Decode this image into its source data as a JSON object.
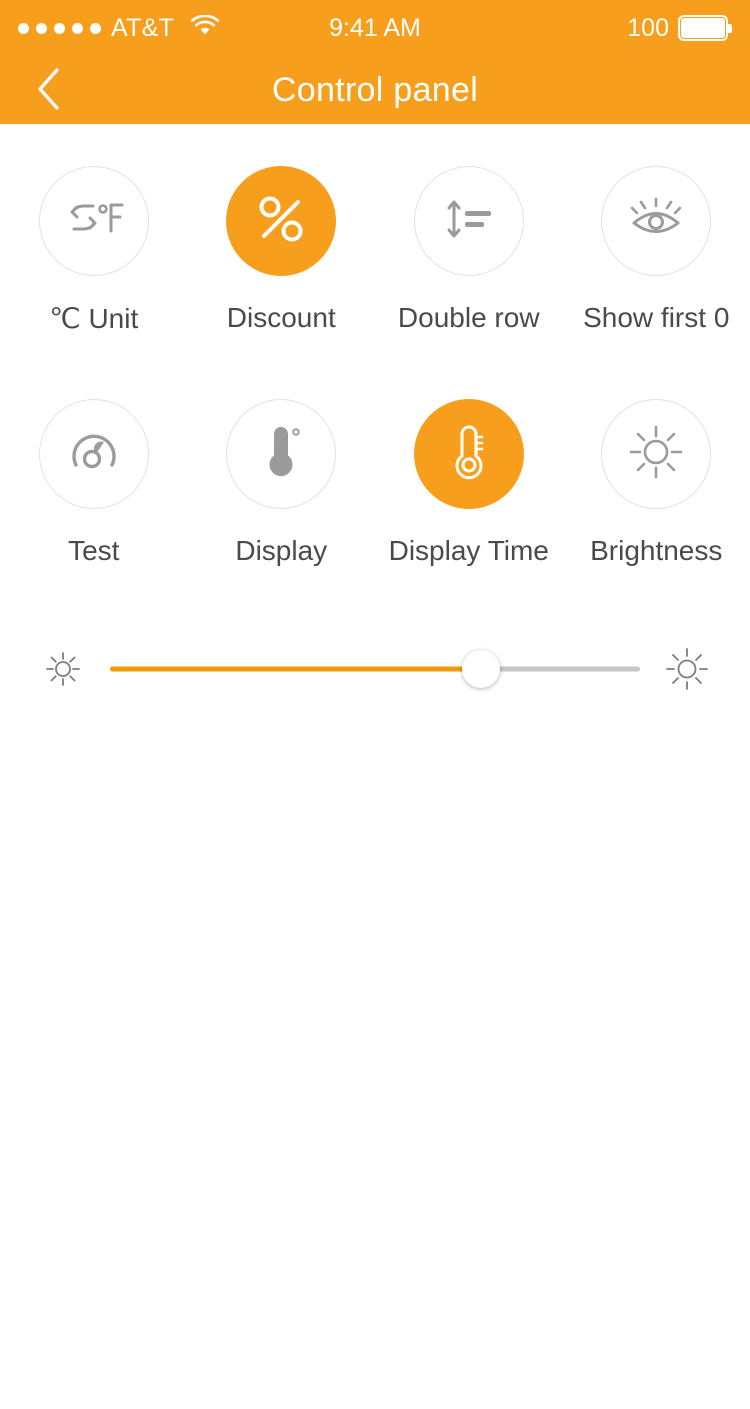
{
  "statusbar": {
    "signal_dots": 5,
    "carrier": "AT&T",
    "wifi_icon": "wifi-icon",
    "time": "9:41 AM",
    "battery_percent": "100",
    "battery_icon": "battery-full-icon"
  },
  "navbar": {
    "back_icon": "chevron-left-icon",
    "title": "Control panel"
  },
  "colors": {
    "accent": "#F79F1C",
    "track_fill": "#ED9B0B",
    "track_bg": "#C6C6C6",
    "circle_border": "#E2E2E2",
    "label_text": "#4A4A4A",
    "icon_gray": "#9B9B9B"
  },
  "grid": {
    "row1": [
      {
        "label": "℃ Unit",
        "icon": "celsius-fahrenheit-swap-icon",
        "active": false
      },
      {
        "label": "Discount",
        "icon": "percent-icon",
        "active": true
      },
      {
        "label": "Double row",
        "icon": "double-row-icon",
        "active": false
      },
      {
        "label": "Show first 0",
        "icon": "eye-icon",
        "active": false
      }
    ],
    "row2": [
      {
        "label": "Test",
        "icon": "gauge-icon",
        "active": false
      },
      {
        "label": "Display",
        "icon": "thermometer-icon",
        "active": false
      },
      {
        "label": "Display Time",
        "icon": "thermometer-outline-icon",
        "active": true
      },
      {
        "label": "Brightness",
        "icon": "sun-icon",
        "active": false
      }
    ]
  },
  "slider": {
    "name": "brightness-slider",
    "min_icon": "sun-small-icon",
    "max_icon": "sun-large-icon",
    "value_percent": 70
  }
}
